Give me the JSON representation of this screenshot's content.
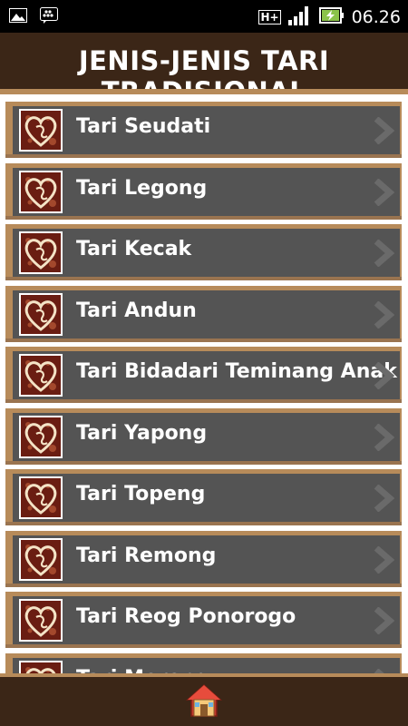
{
  "status_bar": {
    "time": "06.26",
    "network": "H+",
    "icons": [
      "gallery-icon",
      "bbm-icon",
      "network-hplus-icon",
      "signal-icon",
      "battery-charging-icon"
    ]
  },
  "header": {
    "title": "JENIS-JENIS TARI TRADISIONAL"
  },
  "list": {
    "items": [
      {
        "label": "Tari Seudati"
      },
      {
        "label": "Tari Legong"
      },
      {
        "label": "Tari Kecak"
      },
      {
        "label": "Tari Andun"
      },
      {
        "label": "Tari Bidadari Teminang Anak"
      },
      {
        "label": "Tari Yapong"
      },
      {
        "label": "Tari Topeng"
      },
      {
        "label": "Tari Remong"
      },
      {
        "label": "Tari Reog Ponorogo"
      },
      {
        "label": "Tari Merong"
      }
    ],
    "thumbnail_icon": "heart-love-icon",
    "arrow_icon": "chevron-right-icon"
  },
  "footer": {
    "icon": "home-icon"
  },
  "colors": {
    "bar_brown": "#3b2617",
    "accent_tan": "#b78b5a",
    "item_gray": "#545454"
  }
}
